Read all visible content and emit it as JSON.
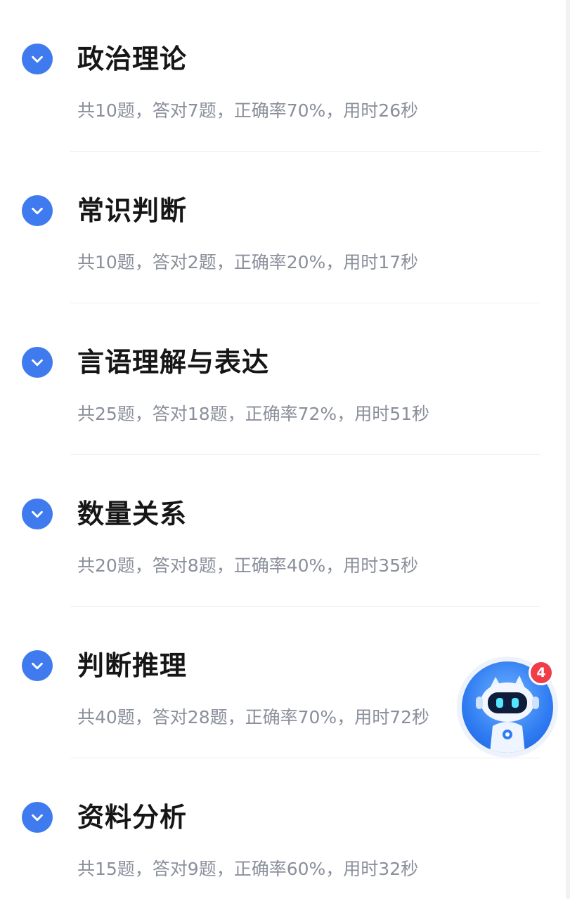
{
  "sections": [
    {
      "title": "政治理论",
      "stats": "共10题，答对7题，正确率70%，用时26秒"
    },
    {
      "title": "常识判断",
      "stats": "共10题，答对2题，正确率20%，用时17秒"
    },
    {
      "title": "言语理解与表达",
      "stats": "共25题，答对18题，正确率72%，用时51秒"
    },
    {
      "title": "数量关系",
      "stats": "共20题，答对8题，正确率40%，用时35秒"
    },
    {
      "title": "判断推理",
      "stats": "共40题，答对28题，正确率70%，用时72秒"
    },
    {
      "title": "资料分析",
      "stats": "共15题，答对9题，正确率60%，用时32秒"
    }
  ],
  "assistant": {
    "badge_count": "4",
    "icon": "robot-assistant-icon"
  },
  "colors": {
    "accent": "#3f7bee",
    "title_text": "#161616",
    "stats_text": "#8a8f9b",
    "badge": "#f03d48"
  }
}
